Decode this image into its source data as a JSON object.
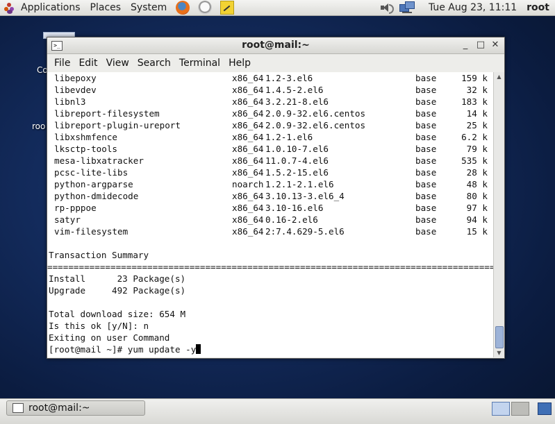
{
  "top_panel": {
    "menus": [
      "Applications",
      "Places",
      "System"
    ],
    "clock": "Tue Aug 23, 11:11",
    "user": "root"
  },
  "window": {
    "title": "root@mail:~",
    "controls": [
      "_",
      "□",
      "✕"
    ],
    "menu": [
      "File",
      "Edit",
      "View",
      "Search",
      "Terminal",
      "Help"
    ]
  },
  "packages": [
    {
      "name": "libepoxy",
      "arch": "x86_64",
      "version": "1.2-3.el6",
      "repo": "base",
      "size": "159 k"
    },
    {
      "name": "libevdev",
      "arch": "x86_64",
      "version": "1.4.5-2.el6",
      "repo": "base",
      "size": "32 k"
    },
    {
      "name": "libnl3",
      "arch": "x86_64",
      "version": "3.2.21-8.el6",
      "repo": "base",
      "size": "183 k"
    },
    {
      "name": "libreport-filesystem",
      "arch": "x86_64",
      "version": "2.0.9-32.el6.centos",
      "repo": "base",
      "size": "14 k"
    },
    {
      "name": "libreport-plugin-ureport",
      "arch": "x86_64",
      "version": "2.0.9-32.el6.centos",
      "repo": "base",
      "size": "25 k"
    },
    {
      "name": "libxshmfence",
      "arch": "x86_64",
      "version": "1.2-1.el6",
      "repo": "base",
      "size": "6.2 k"
    },
    {
      "name": "lksctp-tools",
      "arch": "x86_64",
      "version": "1.0.10-7.el6",
      "repo": "base",
      "size": "79 k"
    },
    {
      "name": "mesa-libxatracker",
      "arch": "x86_64",
      "version": "11.0.7-4.el6",
      "repo": "base",
      "size": "535 k"
    },
    {
      "name": "pcsc-lite-libs",
      "arch": "x86_64",
      "version": "1.5.2-15.el6",
      "repo": "base",
      "size": "28 k"
    },
    {
      "name": "python-argparse",
      "arch": "noarch",
      "version": "1.2.1-2.1.el6",
      "repo": "base",
      "size": "48 k"
    },
    {
      "name": "python-dmidecode",
      "arch": "x86_64",
      "version": "3.10.13-3.el6_4",
      "repo": "base",
      "size": "80 k"
    },
    {
      "name": "rp-pppoe",
      "arch": "x86_64",
      "version": "3.10-16.el6",
      "repo": "base",
      "size": "97 k"
    },
    {
      "name": "satyr",
      "arch": "x86_64",
      "version": "0.16-2.el6",
      "repo": "base",
      "size": "94 k"
    },
    {
      "name": "vim-filesystem",
      "arch": "x86_64",
      "version": "2:7.4.629-5.el6",
      "repo": "base",
      "size": "15 k"
    }
  ],
  "summary": {
    "heading": "Transaction Summary",
    "separator": "==============================================================================================",
    "install": "Install      23 Package(s)",
    "upgrade": "Upgrade     492 Package(s)",
    "download_size": "Total download size: 654 M",
    "prompt": "Is this ok [y/N]: n",
    "exiting": "Exiting on user Command",
    "command_line": "[root@mail ~]# yum update -y"
  },
  "taskbar": {
    "task_label": "root@mail:~"
  },
  "icons": {
    "apps": "gnome-foot-icon",
    "firefox": "firefox-icon",
    "mail": "evolution-mail-icon",
    "notes": "notepad-icon",
    "volume": "speaker-icon",
    "network": "network-icon"
  }
}
